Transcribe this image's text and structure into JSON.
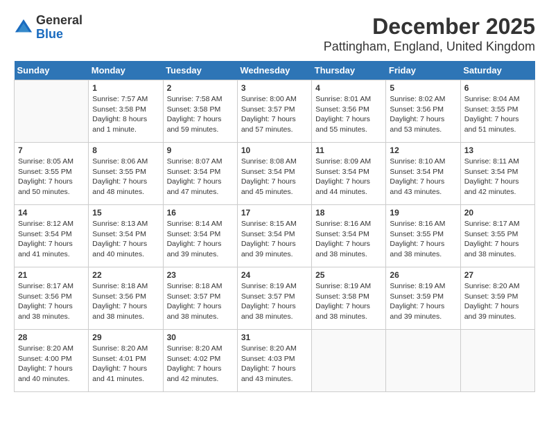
{
  "logo": {
    "general": "General",
    "blue": "Blue"
  },
  "title": "December 2025",
  "subtitle": "Pattingham, England, United Kingdom",
  "days": [
    "Sunday",
    "Monday",
    "Tuesday",
    "Wednesday",
    "Thursday",
    "Friday",
    "Saturday"
  ],
  "weeks": [
    [
      {
        "date": "",
        "info": ""
      },
      {
        "date": "1",
        "info": "Sunrise: 7:57 AM\nSunset: 3:58 PM\nDaylight: 8 hours\nand 1 minute."
      },
      {
        "date": "2",
        "info": "Sunrise: 7:58 AM\nSunset: 3:58 PM\nDaylight: 7 hours\nand 59 minutes."
      },
      {
        "date": "3",
        "info": "Sunrise: 8:00 AM\nSunset: 3:57 PM\nDaylight: 7 hours\nand 57 minutes."
      },
      {
        "date": "4",
        "info": "Sunrise: 8:01 AM\nSunset: 3:56 PM\nDaylight: 7 hours\nand 55 minutes."
      },
      {
        "date": "5",
        "info": "Sunrise: 8:02 AM\nSunset: 3:56 PM\nDaylight: 7 hours\nand 53 minutes."
      },
      {
        "date": "6",
        "info": "Sunrise: 8:04 AM\nSunset: 3:55 PM\nDaylight: 7 hours\nand 51 minutes."
      }
    ],
    [
      {
        "date": "7",
        "info": "Sunrise: 8:05 AM\nSunset: 3:55 PM\nDaylight: 7 hours\nand 50 minutes."
      },
      {
        "date": "8",
        "info": "Sunrise: 8:06 AM\nSunset: 3:55 PM\nDaylight: 7 hours\nand 48 minutes."
      },
      {
        "date": "9",
        "info": "Sunrise: 8:07 AM\nSunset: 3:54 PM\nDaylight: 7 hours\nand 47 minutes."
      },
      {
        "date": "10",
        "info": "Sunrise: 8:08 AM\nSunset: 3:54 PM\nDaylight: 7 hours\nand 45 minutes."
      },
      {
        "date": "11",
        "info": "Sunrise: 8:09 AM\nSunset: 3:54 PM\nDaylight: 7 hours\nand 44 minutes."
      },
      {
        "date": "12",
        "info": "Sunrise: 8:10 AM\nSunset: 3:54 PM\nDaylight: 7 hours\nand 43 minutes."
      },
      {
        "date": "13",
        "info": "Sunrise: 8:11 AM\nSunset: 3:54 PM\nDaylight: 7 hours\nand 42 minutes."
      }
    ],
    [
      {
        "date": "14",
        "info": "Sunrise: 8:12 AM\nSunset: 3:54 PM\nDaylight: 7 hours\nand 41 minutes."
      },
      {
        "date": "15",
        "info": "Sunrise: 8:13 AM\nSunset: 3:54 PM\nDaylight: 7 hours\nand 40 minutes."
      },
      {
        "date": "16",
        "info": "Sunrise: 8:14 AM\nSunset: 3:54 PM\nDaylight: 7 hours\nand 39 minutes."
      },
      {
        "date": "17",
        "info": "Sunrise: 8:15 AM\nSunset: 3:54 PM\nDaylight: 7 hours\nand 39 minutes."
      },
      {
        "date": "18",
        "info": "Sunrise: 8:16 AM\nSunset: 3:54 PM\nDaylight: 7 hours\nand 38 minutes."
      },
      {
        "date": "19",
        "info": "Sunrise: 8:16 AM\nSunset: 3:55 PM\nDaylight: 7 hours\nand 38 minutes."
      },
      {
        "date": "20",
        "info": "Sunrise: 8:17 AM\nSunset: 3:55 PM\nDaylight: 7 hours\nand 38 minutes."
      }
    ],
    [
      {
        "date": "21",
        "info": "Sunrise: 8:17 AM\nSunset: 3:56 PM\nDaylight: 7 hours\nand 38 minutes."
      },
      {
        "date": "22",
        "info": "Sunrise: 8:18 AM\nSunset: 3:56 PM\nDaylight: 7 hours\nand 38 minutes."
      },
      {
        "date": "23",
        "info": "Sunrise: 8:18 AM\nSunset: 3:57 PM\nDaylight: 7 hours\nand 38 minutes."
      },
      {
        "date": "24",
        "info": "Sunrise: 8:19 AM\nSunset: 3:57 PM\nDaylight: 7 hours\nand 38 minutes."
      },
      {
        "date": "25",
        "info": "Sunrise: 8:19 AM\nSunset: 3:58 PM\nDaylight: 7 hours\nand 38 minutes."
      },
      {
        "date": "26",
        "info": "Sunrise: 8:19 AM\nSunset: 3:59 PM\nDaylight: 7 hours\nand 39 minutes."
      },
      {
        "date": "27",
        "info": "Sunrise: 8:20 AM\nSunset: 3:59 PM\nDaylight: 7 hours\nand 39 minutes."
      }
    ],
    [
      {
        "date": "28",
        "info": "Sunrise: 8:20 AM\nSunset: 4:00 PM\nDaylight: 7 hours\nand 40 minutes."
      },
      {
        "date": "29",
        "info": "Sunrise: 8:20 AM\nSunset: 4:01 PM\nDaylight: 7 hours\nand 41 minutes."
      },
      {
        "date": "30",
        "info": "Sunrise: 8:20 AM\nSunset: 4:02 PM\nDaylight: 7 hours\nand 42 minutes."
      },
      {
        "date": "31",
        "info": "Sunrise: 8:20 AM\nSunset: 4:03 PM\nDaylight: 7 hours\nand 43 minutes."
      },
      {
        "date": "",
        "info": ""
      },
      {
        "date": "",
        "info": ""
      },
      {
        "date": "",
        "info": ""
      }
    ]
  ]
}
